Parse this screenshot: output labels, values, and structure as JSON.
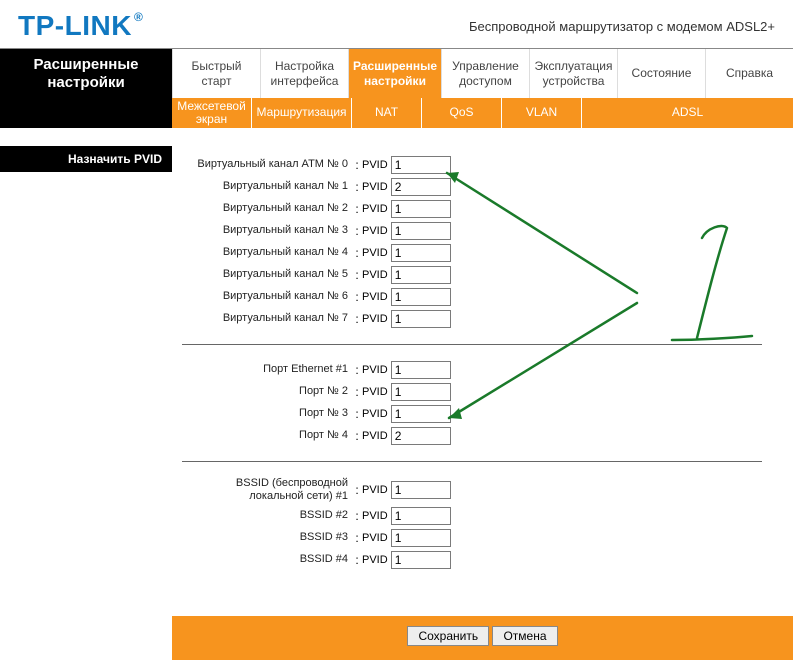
{
  "brand": "TP-LINK",
  "brand_mark": "®",
  "header_subtitle": "Беспроводной маршрутизатор с модемом ADSL2+",
  "sidebar_title": "Расширенные настройки",
  "nav": {
    "tabs": [
      {
        "label": "Быстрый старт"
      },
      {
        "label": "Настройка интерфейса"
      },
      {
        "label": "Расширенные настройки",
        "active": true
      },
      {
        "label": "Управление доступом"
      },
      {
        "label": "Эксплуатация устройства"
      },
      {
        "label": "Состояние"
      },
      {
        "label": "Справка"
      }
    ]
  },
  "subnav": {
    "tabs": [
      {
        "label": "Межсетевой экран"
      },
      {
        "label": "Маршрутизация"
      },
      {
        "label": "NAT"
      },
      {
        "label": "QoS"
      },
      {
        "label": "VLAN"
      },
      {
        "label": "ADSL"
      }
    ]
  },
  "section_title": "Назначить PVID",
  "pvid_label": "PVID",
  "groups": {
    "atm": [
      {
        "label": "Виртуальный канал ATM № 0",
        "value": "1"
      },
      {
        "label": "Виртуальный канал № 1",
        "value": "2"
      },
      {
        "label": "Виртуальный канал № 2",
        "value": "1"
      },
      {
        "label": "Виртуальный канал № 3",
        "value": "1"
      },
      {
        "label": "Виртуальный канал № 4",
        "value": "1"
      },
      {
        "label": "Виртуальный канал № 5",
        "value": "1"
      },
      {
        "label": "Виртуальный канал № 6",
        "value": "1"
      },
      {
        "label": "Виртуальный канал № 7",
        "value": "1"
      }
    ],
    "eth": [
      {
        "label": "Порт Ethernet #1",
        "value": "1"
      },
      {
        "label": "Порт № 2",
        "value": "1"
      },
      {
        "label": "Порт № 3",
        "value": "1"
      },
      {
        "label": "Порт № 4",
        "value": "2"
      }
    ],
    "bssid": [
      {
        "label": "BSSID (беспроводной локальной сети) #1",
        "value": "1"
      },
      {
        "label": "BSSID #2",
        "value": "1"
      },
      {
        "label": "BSSID #3",
        "value": "1"
      },
      {
        "label": "BSSID #4",
        "value": "1"
      }
    ]
  },
  "buttons": {
    "save": "Сохранить",
    "cancel": "Отмена"
  },
  "annotation": {
    "digit": "1"
  }
}
